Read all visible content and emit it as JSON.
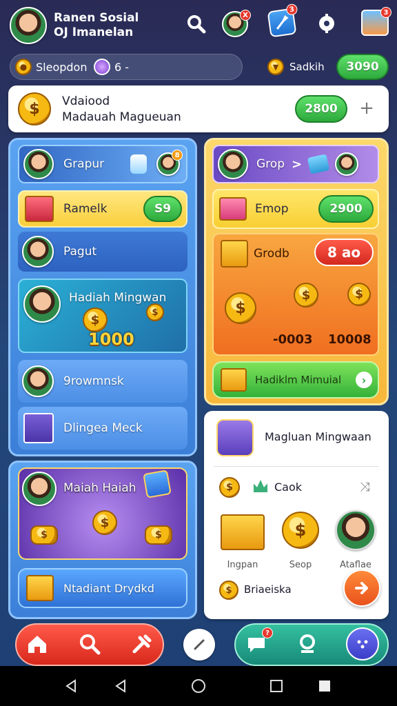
{
  "header": {
    "title_line1": "Ranen Sosial",
    "title_line2": "OJ Imanelan",
    "icons": [
      "search-icon",
      "friend-avatar-icon",
      "tools-icon",
      "settings-icon",
      "gift-cards-icon"
    ],
    "badges": {
      "friend": "X",
      "tools": "3",
      "cards": "3"
    }
  },
  "stats": {
    "coin_label": "Sleopdon",
    "gem_value": "6 -",
    "trophy_label": "Sadkih",
    "total_button": "3090"
  },
  "banner": {
    "title": "Vdaiood",
    "subtitle": "Madauah Magueuan",
    "button": "2800",
    "plus": "+"
  },
  "left_panel": {
    "rows": [
      {
        "label": "Grapur",
        "badge": "8"
      },
      {
        "label": "Ramelk",
        "button": "S9"
      },
      {
        "label": "Pagut"
      }
    ],
    "reward": {
      "title": "Hadiah Mingwan",
      "amount": "1000"
    },
    "rows2": [
      {
        "label": "9rowmnsk"
      },
      {
        "label": "Dlingea Meck"
      }
    ]
  },
  "right_panel": {
    "rows": [
      {
        "label": "Grop",
        "arrow": ">"
      },
      {
        "label": "Emop",
        "button": "2900"
      }
    ],
    "gold": {
      "label": "Grodb",
      "button": "8 ao",
      "value1": "-0003",
      "value2": "10008"
    },
    "bottom_button": "Hadiklm Mimuial"
  },
  "left_bottom": {
    "title": "Maiah Haiah",
    "button": "Ntadiant Drydkd"
  },
  "right_bottom": {
    "title": "Magluan Mingwaan",
    "cash_label": "Caok",
    "items": [
      {
        "label": "Ingpan"
      },
      {
        "label": "Seop"
      },
      {
        "label": "Ataflae"
      }
    ],
    "footer_label": "Briaeiska"
  },
  "bottom_nav": {
    "items": [
      "home-icon",
      "search-icon",
      "tools-icon",
      "edit-icon",
      "chat-icon",
      "location-icon",
      "more-icon"
    ],
    "chat_badge": "?"
  },
  "system_nav": {
    "items": [
      "back-icon",
      "back-alt-icon",
      "home-circle-icon",
      "recents-icon",
      "stop-icon"
    ]
  }
}
